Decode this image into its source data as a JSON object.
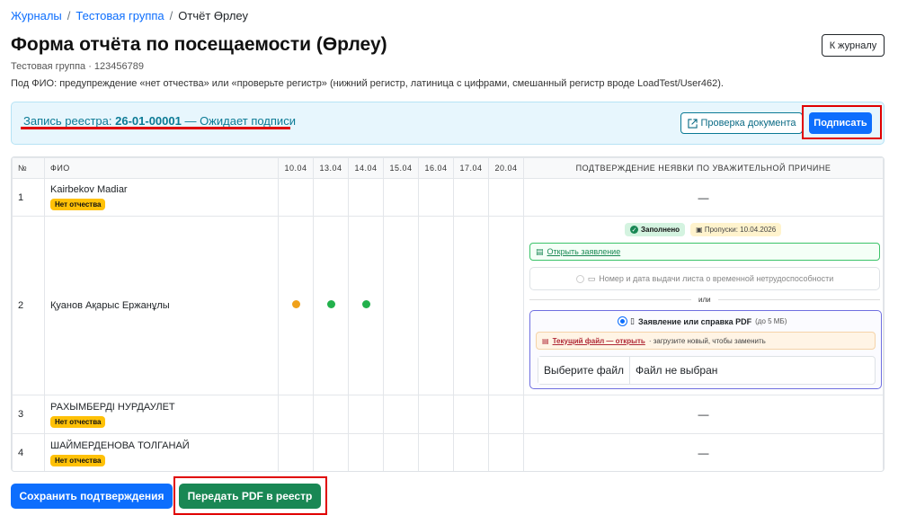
{
  "breadcrumb": {
    "items": [
      "Журналы",
      "Тестовая группа"
    ],
    "current": "Отчёт Өрлеу",
    "sep": "/"
  },
  "header": {
    "title": "Форма отчёта по посещаемости (Өрлеу)",
    "back_button": "К журналу",
    "subtitle": "Тестовая группа · 123456789",
    "hint": "Под ФИО: предупреждение «нет отчества» или «проверьте регистр» (нижний регистр, латиница с цифрами, смешанный регистр вроде LoadTest/User462)."
  },
  "registry": {
    "prefix": "Запись реестра: ",
    "number": "26-01-00001",
    "status": " — Ожидает подписи",
    "check_button": "Проверка документа",
    "sign_button": "Подписать"
  },
  "table": {
    "headers": {
      "num": "№",
      "name": "ФИО",
      "confirm": "ПОДТВЕРЖДЕНИЕ НЕЯВКИ ПО УВАЖИТЕЛЬНОЙ ПРИЧИНЕ"
    },
    "dates": [
      "10.04",
      "13.04",
      "14.04",
      "15.04",
      "16.04",
      "17.04",
      "20.04"
    ],
    "rows": [
      {
        "num": "1",
        "name": "Kairbekov Madiar",
        "badge": "Нет отчества",
        "confirm": "—"
      },
      {
        "num": "2",
        "name": "Қуанов Ақарыс Ержанұлы",
        "badge": "",
        "confirm": ""
      },
      {
        "num": "3",
        "name": "РАХЫМБЕРДІ НУРДАУЛЕТ",
        "badge": "Нет отчества",
        "confirm": "—"
      },
      {
        "num": "4",
        "name": "ШАЙМЕРДЕНОВА ТОЛГАНАЙ",
        "badge": "Нет отчества",
        "confirm": "—"
      }
    ],
    "attendance_colors": {
      "late": "#f0a11a",
      "present": "#22b14c"
    }
  },
  "confirm_panel": {
    "status_tag": "Заполнено",
    "skip_tag": "Пропуски: 10.04.2026",
    "open_application": "Открыть заявление",
    "sick_option": "Номер и дата выдачи листа о временной нетрудоспособности",
    "or": "или",
    "pdf_option": "Заявление или справка PDF",
    "pdf_limit": "(до 5 МБ)",
    "current_file_link": "Текущий файл — открыть",
    "current_file_hint": "· загрузите новый, чтобы заменить",
    "file_button": "Выберите файл",
    "file_status": "Файл не выбран"
  },
  "actions": {
    "save": "Сохранить подтверждения",
    "send": "Передать PDF в реестр"
  }
}
